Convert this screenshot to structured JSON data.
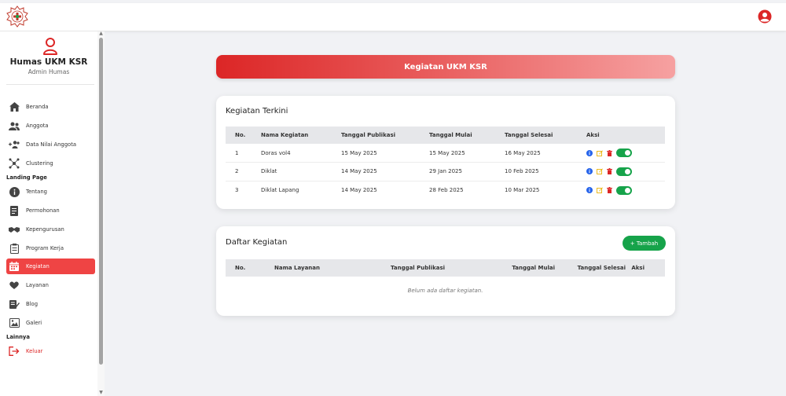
{
  "sidebar": {
    "profile_name": "Humas UKM KSR",
    "profile_role": "Admin Humas",
    "items": [
      {
        "label": "Beranda"
      },
      {
        "label": "Anggota"
      },
      {
        "label": "Data Nilai Anggota"
      },
      {
        "label": "Clustering"
      }
    ],
    "section_landing": "Landing Page",
    "landing_items": [
      {
        "label": "Tentang"
      },
      {
        "label": "Permohonan"
      },
      {
        "label": "Kepengurusan"
      },
      {
        "label": "Program Kerja"
      },
      {
        "label": "Kegiatan"
      },
      {
        "label": "Layanan"
      },
      {
        "label": "Blog"
      },
      {
        "label": "Galeri"
      }
    ],
    "section_other": "Lainnya",
    "logout_label": "Keluar"
  },
  "banner": {
    "title": "Kegiatan UKM KSR"
  },
  "recent": {
    "title": "Kegiatan Terkini",
    "columns": [
      "No.",
      "Nama Kegiatan",
      "Tanggal Publikasi",
      "Tanggal Mulai",
      "Tanggal Selesai",
      "Aksi"
    ],
    "rows": [
      [
        "1",
        "Doras vol4",
        "15 May 2025",
        "15 May 2025",
        "16 May 2025"
      ],
      [
        "2",
        "Diklat",
        "14 May 2025",
        "29 Jan 2025",
        "10 Feb 2025"
      ],
      [
        "3",
        "Diklat Lapang",
        "14 May 2025",
        "28 Feb 2025",
        "10 Mar 2025"
      ]
    ]
  },
  "list": {
    "title": "Daftar Kegiatan",
    "add_label": "+ Tambah",
    "columns": [
      "No.",
      "Nama Layanan",
      "Tanggal Publikasi",
      "Tanggal Mulai",
      "Tanggal Selesai",
      "Aksi"
    ],
    "empty_text": "Belum ada daftar kegiatan."
  },
  "colors": {
    "accent": "#ef4444",
    "success": "#16a34a",
    "info": "#2563eb",
    "edit": "#eab308",
    "danger": "#dc2626"
  },
  "icons": [
    "logo",
    "user-circle-icon",
    "user-icon",
    "home-icon",
    "users-icon",
    "user-plus-icon",
    "network-icon",
    "info-icon",
    "document-icon",
    "handshake-icon",
    "clipboard-icon",
    "calendar-icon",
    "heart-hand-icon",
    "blog-icon",
    "gallery-icon",
    "logout-icon",
    "edit-icon",
    "trash-icon",
    "toggle-icon"
  ]
}
